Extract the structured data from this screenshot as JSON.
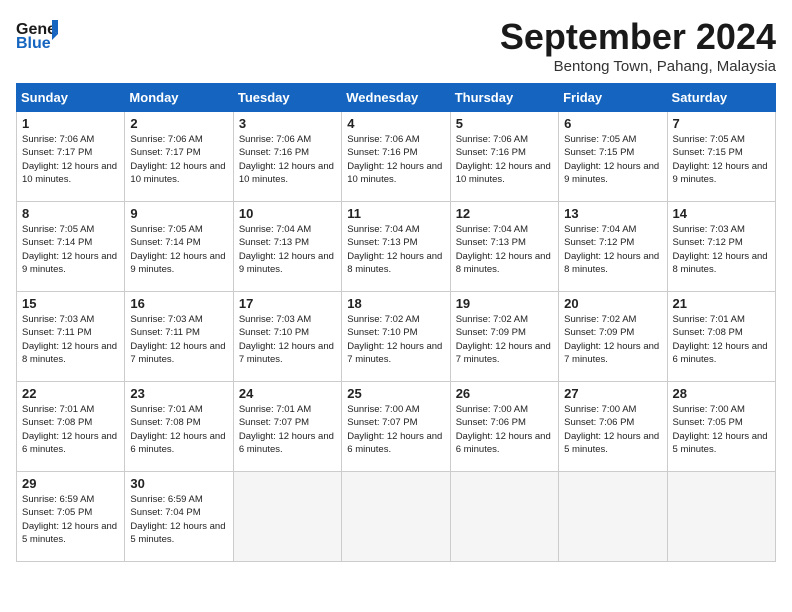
{
  "header": {
    "logo_general": "General",
    "logo_blue": "Blue",
    "month": "September 2024",
    "location": "Bentong Town, Pahang, Malaysia"
  },
  "days": [
    "Sunday",
    "Monday",
    "Tuesday",
    "Wednesday",
    "Thursday",
    "Friday",
    "Saturday"
  ],
  "cells": [
    {
      "day": 1,
      "sunrise": "7:06 AM",
      "sunset": "7:17 PM",
      "daylight": "12 hours and 10 minutes."
    },
    {
      "day": 2,
      "sunrise": "7:06 AM",
      "sunset": "7:17 PM",
      "daylight": "12 hours and 10 minutes."
    },
    {
      "day": 3,
      "sunrise": "7:06 AM",
      "sunset": "7:16 PM",
      "daylight": "12 hours and 10 minutes."
    },
    {
      "day": 4,
      "sunrise": "7:06 AM",
      "sunset": "7:16 PM",
      "daylight": "12 hours and 10 minutes."
    },
    {
      "day": 5,
      "sunrise": "7:06 AM",
      "sunset": "7:16 PM",
      "daylight": "12 hours and 10 minutes."
    },
    {
      "day": 6,
      "sunrise": "7:05 AM",
      "sunset": "7:15 PM",
      "daylight": "12 hours and 9 minutes."
    },
    {
      "day": 7,
      "sunrise": "7:05 AM",
      "sunset": "7:15 PM",
      "daylight": "12 hours and 9 minutes."
    },
    {
      "day": 8,
      "sunrise": "7:05 AM",
      "sunset": "7:14 PM",
      "daylight": "12 hours and 9 minutes."
    },
    {
      "day": 9,
      "sunrise": "7:05 AM",
      "sunset": "7:14 PM",
      "daylight": "12 hours and 9 minutes."
    },
    {
      "day": 10,
      "sunrise": "7:04 AM",
      "sunset": "7:13 PM",
      "daylight": "12 hours and 9 minutes."
    },
    {
      "day": 11,
      "sunrise": "7:04 AM",
      "sunset": "7:13 PM",
      "daylight": "12 hours and 8 minutes."
    },
    {
      "day": 12,
      "sunrise": "7:04 AM",
      "sunset": "7:13 PM",
      "daylight": "12 hours and 8 minutes."
    },
    {
      "day": 13,
      "sunrise": "7:04 AM",
      "sunset": "7:12 PM",
      "daylight": "12 hours and 8 minutes."
    },
    {
      "day": 14,
      "sunrise": "7:03 AM",
      "sunset": "7:12 PM",
      "daylight": "12 hours and 8 minutes."
    },
    {
      "day": 15,
      "sunrise": "7:03 AM",
      "sunset": "7:11 PM",
      "daylight": "12 hours and 8 minutes."
    },
    {
      "day": 16,
      "sunrise": "7:03 AM",
      "sunset": "7:11 PM",
      "daylight": "12 hours and 7 minutes."
    },
    {
      "day": 17,
      "sunrise": "7:03 AM",
      "sunset": "7:10 PM",
      "daylight": "12 hours and 7 minutes."
    },
    {
      "day": 18,
      "sunrise": "7:02 AM",
      "sunset": "7:10 PM",
      "daylight": "12 hours and 7 minutes."
    },
    {
      "day": 19,
      "sunrise": "7:02 AM",
      "sunset": "7:09 PM",
      "daylight": "12 hours and 7 minutes."
    },
    {
      "day": 20,
      "sunrise": "7:02 AM",
      "sunset": "7:09 PM",
      "daylight": "12 hours and 7 minutes."
    },
    {
      "day": 21,
      "sunrise": "7:01 AM",
      "sunset": "7:08 PM",
      "daylight": "12 hours and 6 minutes."
    },
    {
      "day": 22,
      "sunrise": "7:01 AM",
      "sunset": "7:08 PM",
      "daylight": "12 hours and 6 minutes."
    },
    {
      "day": 23,
      "sunrise": "7:01 AM",
      "sunset": "7:08 PM",
      "daylight": "12 hours and 6 minutes."
    },
    {
      "day": 24,
      "sunrise": "7:01 AM",
      "sunset": "7:07 PM",
      "daylight": "12 hours and 6 minutes."
    },
    {
      "day": 25,
      "sunrise": "7:00 AM",
      "sunset": "7:07 PM",
      "daylight": "12 hours and 6 minutes."
    },
    {
      "day": 26,
      "sunrise": "7:00 AM",
      "sunset": "7:06 PM",
      "daylight": "12 hours and 6 minutes."
    },
    {
      "day": 27,
      "sunrise": "7:00 AM",
      "sunset": "7:06 PM",
      "daylight": "12 hours and 5 minutes."
    },
    {
      "day": 28,
      "sunrise": "7:00 AM",
      "sunset": "7:05 PM",
      "daylight": "12 hours and 5 minutes."
    },
    {
      "day": 29,
      "sunrise": "6:59 AM",
      "sunset": "7:05 PM",
      "daylight": "12 hours and 5 minutes."
    },
    {
      "day": 30,
      "sunrise": "6:59 AM",
      "sunset": "7:04 PM",
      "daylight": "12 hours and 5 minutes."
    }
  ]
}
